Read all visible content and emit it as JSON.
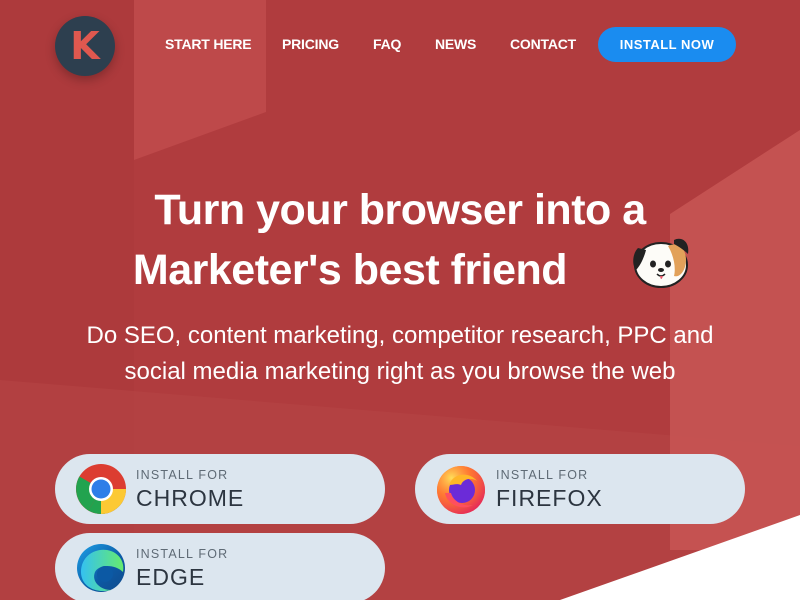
{
  "logo": {
    "letter": "K"
  },
  "nav": {
    "items": [
      "START HERE",
      "PRICING",
      "FAQ",
      "NEWS",
      "CONTACT"
    ],
    "install_label": "INSTALL NOW"
  },
  "hero": {
    "title_line1": "Turn your browser into a",
    "title_line2": "Marketer's best friend",
    "mascot_icon": "dog-face-icon",
    "subtitle_line1": "Do SEO, content marketing, competitor research, PPC and",
    "subtitle_line2": "social media marketing right as you browse the web"
  },
  "install_buttons": [
    {
      "prefix": "INSTALL FOR",
      "browser": "CHROME",
      "icon": "chrome-icon"
    },
    {
      "prefix": "INSTALL FOR",
      "browser": "FIREFOX",
      "icon": "firefox-icon"
    },
    {
      "prefix": "INSTALL FOR",
      "browser": "EDGE",
      "icon": "edge-icon"
    }
  ],
  "colors": {
    "background": "#b03c3e",
    "accent": "#1a8cf0",
    "logo_bg": "#2d3f4f",
    "button_bg": "#dce6ef"
  }
}
